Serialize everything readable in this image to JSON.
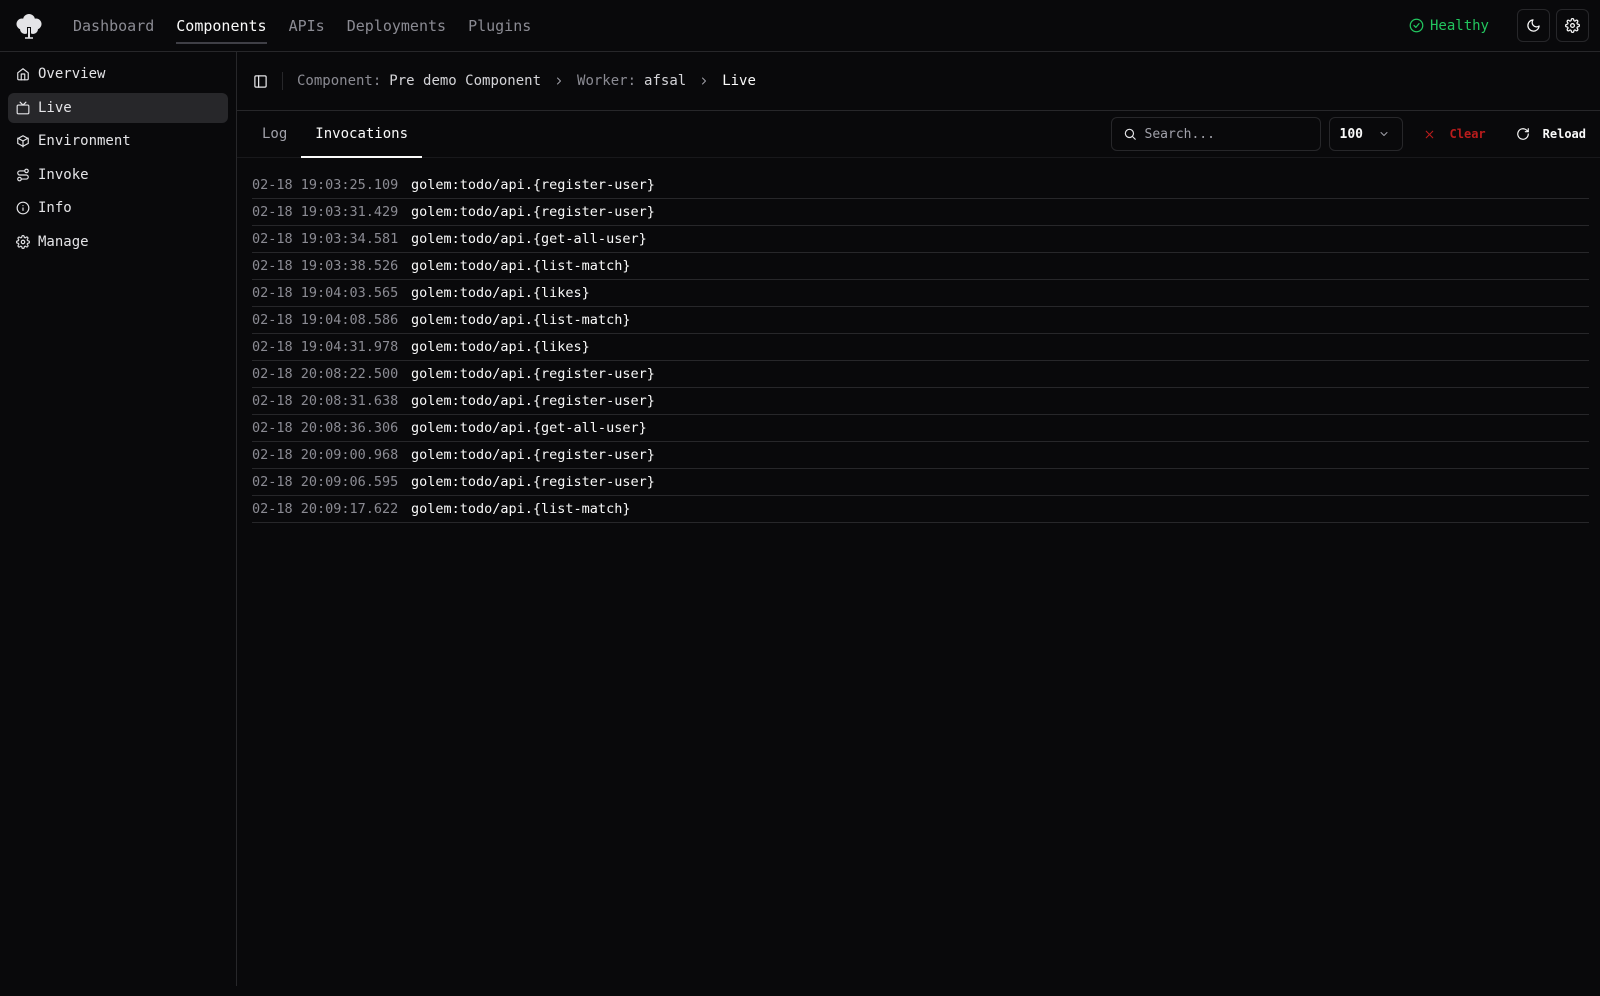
{
  "app": {
    "logo_icon": "golem-tree-icon",
    "nav": [
      {
        "label": "Dashboard",
        "active": false
      },
      {
        "label": "Components",
        "active": true
      },
      {
        "label": "APIs",
        "active": false
      },
      {
        "label": "Deployments",
        "active": false
      },
      {
        "label": "Plugins",
        "active": false
      }
    ],
    "health": {
      "label": "Healthy",
      "color": "#22c55e"
    }
  },
  "sidebar": {
    "items": [
      {
        "label": "Overview",
        "icon": "home-icon"
      },
      {
        "label": "Live",
        "icon": "tv-icon",
        "active": true
      },
      {
        "label": "Environment",
        "icon": "box-icon"
      },
      {
        "label": "Invoke",
        "icon": "route-icon"
      },
      {
        "label": "Info",
        "icon": "info-icon"
      },
      {
        "label": "Manage",
        "icon": "gear-icon"
      }
    ]
  },
  "breadcrumb": {
    "component_label": "Component:",
    "component_value": "Pre demo Component",
    "worker_label": "Worker:",
    "worker_value": "afsal",
    "current": "Live"
  },
  "toolbar": {
    "tabs": [
      {
        "label": "Log",
        "active": false
      },
      {
        "label": "Invocations",
        "active": true
      }
    ],
    "search_placeholder": "Search...",
    "limit_value": "100",
    "clear_label": "Clear",
    "reload_label": "Reload"
  },
  "invocations": [
    {
      "timestamp": "02-18 19:03:25.109",
      "function": "golem:todo/api.{register-user}"
    },
    {
      "timestamp": "02-18 19:03:31.429",
      "function": "golem:todo/api.{register-user}"
    },
    {
      "timestamp": "02-18 19:03:34.581",
      "function": "golem:todo/api.{get-all-user}"
    },
    {
      "timestamp": "02-18 19:03:38.526",
      "function": "golem:todo/api.{list-match}"
    },
    {
      "timestamp": "02-18 19:04:03.565",
      "function": "golem:todo/api.{likes}"
    },
    {
      "timestamp": "02-18 19:04:08.586",
      "function": "golem:todo/api.{list-match}"
    },
    {
      "timestamp": "02-18 19:04:31.978",
      "function": "golem:todo/api.{likes}"
    },
    {
      "timestamp": "02-18 20:08:22.500",
      "function": "golem:todo/api.{register-user}"
    },
    {
      "timestamp": "02-18 20:08:31.638",
      "function": "golem:todo/api.{register-user}"
    },
    {
      "timestamp": "02-18 20:08:36.306",
      "function": "golem:todo/api.{get-all-user}"
    },
    {
      "timestamp": "02-18 20:09:00.968",
      "function": "golem:todo/api.{register-user}"
    },
    {
      "timestamp": "02-18 20:09:06.595",
      "function": "golem:todo/api.{register-user}"
    },
    {
      "timestamp": "02-18 20:09:17.622",
      "function": "golem:todo/api.{list-match}"
    }
  ]
}
